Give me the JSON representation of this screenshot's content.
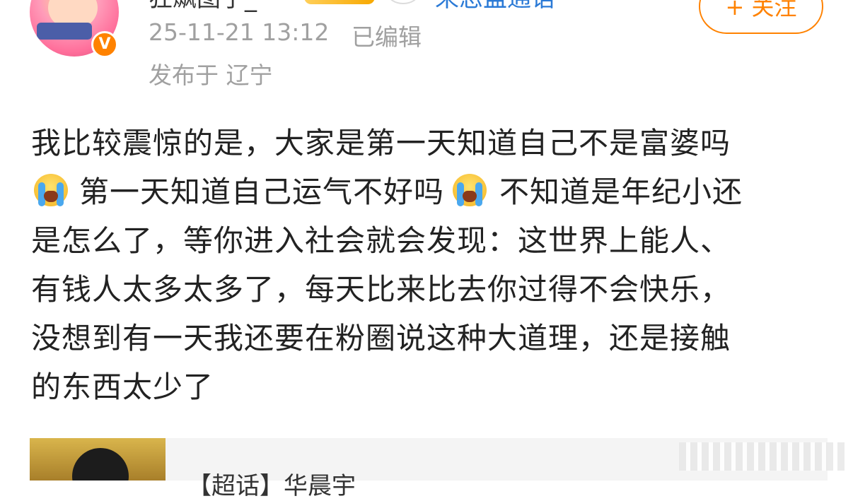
{
  "author": {
    "username": "狂飙图子_",
    "verified_badge": "V",
    "source": "来恋蛊通语"
  },
  "follow_button": {
    "label": "+ 关注"
  },
  "meta": {
    "timestamp": "25-11-21 13:12",
    "edited": "已编辑",
    "location": "发布于 辽宁"
  },
  "post": {
    "lines": {
      "l1": "我比较震惊的是，大家是第一天知道自己不是富婆吗",
      "l2_a": "第一天知道自己运气不好吗",
      "l2_b": "不知道是年纪小还",
      "l3": "是怎么了，等你进入社会就会发现：这世界上能人、",
      "l4": "有钱人太多太多了，每天比来比去你过得不会快乐，",
      "l5": "没想到有一天我还要在粉圈说这种大道理，还是接触",
      "l6": "的东西太少了"
    },
    "emoji_name": "crying-emoji"
  },
  "card": {
    "title": "【超话】华晨宇"
  }
}
